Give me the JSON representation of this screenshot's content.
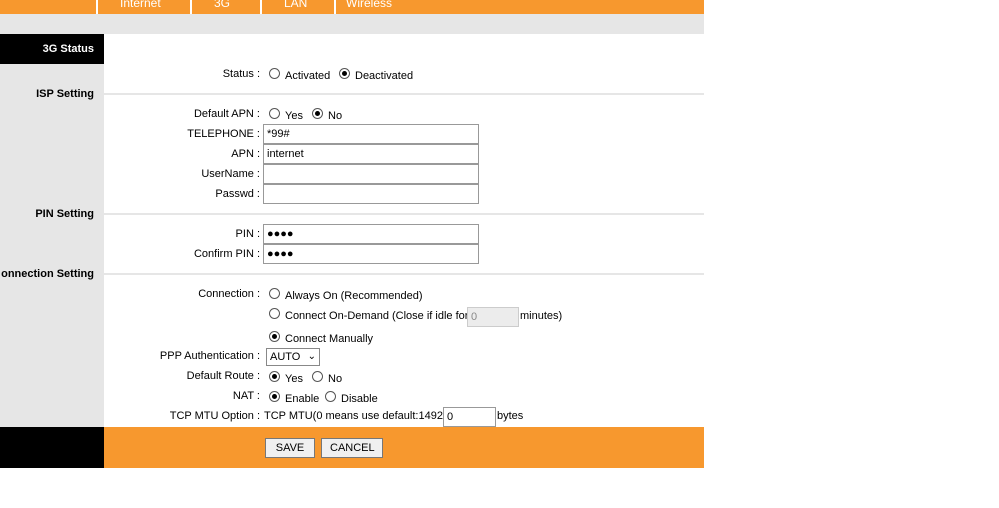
{
  "nav": {
    "tabs": [
      {
        "label": "Internet"
      },
      {
        "label": "3G"
      },
      {
        "label": "LAN"
      },
      {
        "label": "Wireless"
      }
    ]
  },
  "sections": {
    "status": "3G Status",
    "isp": "ISP Setting",
    "pin": "PIN Setting",
    "connection": "onnection Setting"
  },
  "status": {
    "label": "Status :",
    "activated": "Activated",
    "deactivated": "Deactivated",
    "selected": "Deactivated"
  },
  "isp": {
    "default_apn_label": "Default APN :",
    "yes": "Yes",
    "no": "No",
    "default_apn_selected": "No",
    "telephone_label": "TELEPHONE :",
    "telephone_value": "*99#",
    "apn_label": "APN :",
    "apn_value": "internet",
    "username_label": "UserName :",
    "username_value": "",
    "passwd_label": "Passwd :",
    "passwd_value": ""
  },
  "pin": {
    "pin_label": "PIN :",
    "pin_value": "●●●●",
    "confirm_label": "Confirm PIN :",
    "confirm_value": "●●●●"
  },
  "connection": {
    "label": "Connection :",
    "always_on": "Always On (Recommended)",
    "on_demand": "Connect On-Demand (Close if idle for",
    "idle_value": "0",
    "minutes": "minutes)",
    "manual": "Connect Manually",
    "selected": "Connect Manually",
    "ppp_label": "PPP Authentication :",
    "ppp_value": "AUTO",
    "route_label": "Default Route :",
    "route_yes": "Yes",
    "route_no": "No",
    "route_selected": "Yes",
    "nat_label": "NAT :",
    "nat_enable": "Enable",
    "nat_disable": "Disable",
    "nat_selected": "Enable",
    "mtu_label": "TCP MTU Option :",
    "mtu_text": "TCP MTU(0 means use default:1492)",
    "mtu_value": "0",
    "mtu_unit": "bytes"
  },
  "buttons": {
    "save": "SAVE",
    "cancel": "CANCEL"
  },
  "colors": {
    "accent": "#f7982e",
    "sidebar": "#e6e6e6",
    "dark": "#000000"
  }
}
